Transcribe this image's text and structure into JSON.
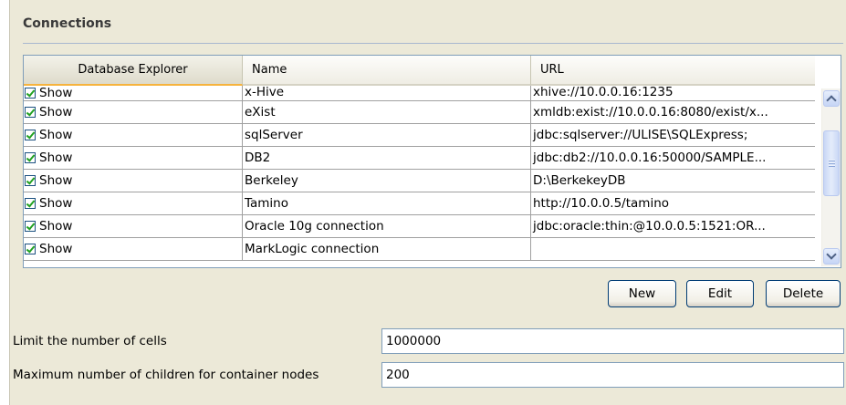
{
  "section": {
    "title": "Connections"
  },
  "table": {
    "columns": [
      "Database Explorer",
      "Name",
      "URL"
    ],
    "rows": [
      {
        "show": "Show",
        "checked": true,
        "name": "x-Hive",
        "url": "xhive://10.0.0.16:1235"
      },
      {
        "show": "Show",
        "checked": true,
        "name": "eXist",
        "url": "xmldb:exist://10.0.0.16:8080/exist/x..."
      },
      {
        "show": "Show",
        "checked": true,
        "name": "sqlServer",
        "url": "jdbc:sqlserver://ULISE\\SQLExpress;"
      },
      {
        "show": "Show",
        "checked": true,
        "name": "DB2",
        "url": "jdbc:db2://10.0.0.16:50000/SAMPLE..."
      },
      {
        "show": "Show",
        "checked": true,
        "name": "Berkeley",
        "url": "D:\\BerkekeyDB"
      },
      {
        "show": "Show",
        "checked": true,
        "name": "Tamino",
        "url": "http://10.0.0.5/tamino"
      },
      {
        "show": "Show",
        "checked": true,
        "name": "Oracle 10g connection",
        "url": "jdbc:oracle:thin:@10.0.0.5:1521:OR..."
      },
      {
        "show": "Show",
        "checked": true,
        "name": "MarkLogic connection",
        "url": ""
      }
    ]
  },
  "buttons": {
    "new": "New",
    "edit": "Edit",
    "delete": "Delete"
  },
  "settings": {
    "limit_cells": {
      "label": "Limit the number of cells",
      "value": "1000000"
    },
    "max_children": {
      "label": "Maximum number of children for container nodes",
      "value": "200"
    }
  },
  "colors": {
    "panel_bg": "#ece9d8",
    "header_accent": "#f6b33d",
    "check": "#21a121",
    "border": "#7f9db9"
  }
}
